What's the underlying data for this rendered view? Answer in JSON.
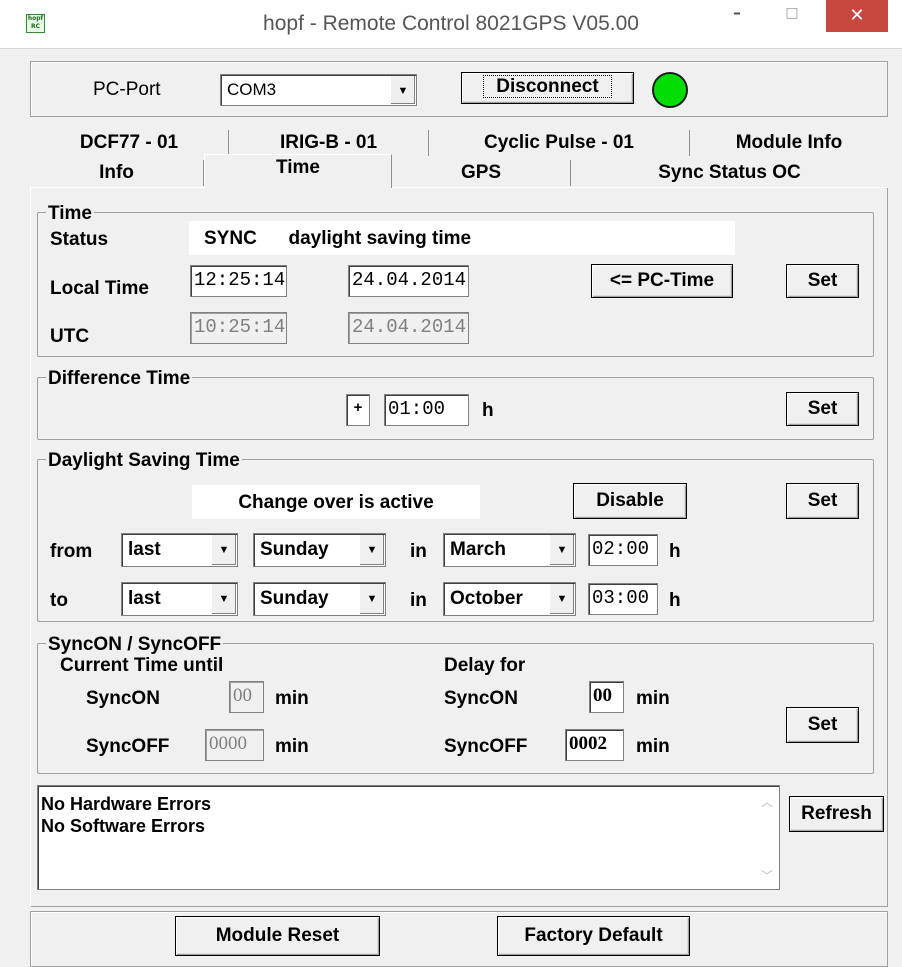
{
  "window": {
    "title": "hopf - Remote Control  8021GPS V05.00",
    "icon_text": "hopf RC",
    "minimize": "–",
    "maximize": "□",
    "close": "✕"
  },
  "connection": {
    "port_label": "PC-Port",
    "port_value": "COM3",
    "disconnect_label": "Disconnect",
    "status_color": "#00dd00"
  },
  "tabs_row1": [
    "DCF77 - 01",
    "IRIG-B - 01",
    "Cyclic Pulse - 01",
    "Module Info"
  ],
  "tabs_row2": [
    "Info",
    "Time",
    "GPS",
    "Sync Status OC"
  ],
  "time": {
    "group_title": "Time",
    "status_label": "Status",
    "status_value": "SYNC      daylight saving time",
    "local_label": "Local Time",
    "local_time": "12:25:14",
    "local_date": "24.04.2014",
    "pc_time_button": "<= PC-Time",
    "set_button": "Set",
    "utc_label": "UTC",
    "utc_time": "10:25:14",
    "utc_date": "24.04.2014"
  },
  "difference": {
    "group_title": "Difference Time",
    "sign": "+",
    "value": "01:00",
    "unit": "h",
    "set_button": "Set"
  },
  "dst": {
    "group_title": "Daylight Saving Time",
    "status": "Change over is active",
    "disable_button": "Disable",
    "set_button": "Set",
    "from_label": "from",
    "from_week": "last",
    "from_day": "Sunday",
    "from_in": "in",
    "from_month": "March",
    "from_time": "02:00",
    "from_unit": "h",
    "to_label": "to",
    "to_week": "last",
    "to_day": "Sunday",
    "to_in": "in",
    "to_month": "October",
    "to_time": "03:00",
    "to_unit": "h"
  },
  "sync": {
    "group_title": "SyncON / SyncOFF",
    "current_label": "Current Time until",
    "delay_label": "Delay for",
    "cur_on_label": "SyncON",
    "cur_on_value": "00",
    "cur_on_unit": "min",
    "cur_off_label": "SyncOFF",
    "cur_off_value": "0000",
    "cur_off_unit": "min",
    "del_on_label": "SyncON",
    "del_on_value": "00",
    "del_on_unit": "min",
    "del_off_label": "SyncOFF",
    "del_off_value": "0002",
    "del_off_unit": "min",
    "set_button": "Set"
  },
  "errors": {
    "lines": [
      "No Hardware Errors",
      "No Software Errors"
    ],
    "refresh_button": "Refresh"
  },
  "footer": {
    "reset_button": "Module Reset",
    "factory_button": "Factory Default"
  }
}
